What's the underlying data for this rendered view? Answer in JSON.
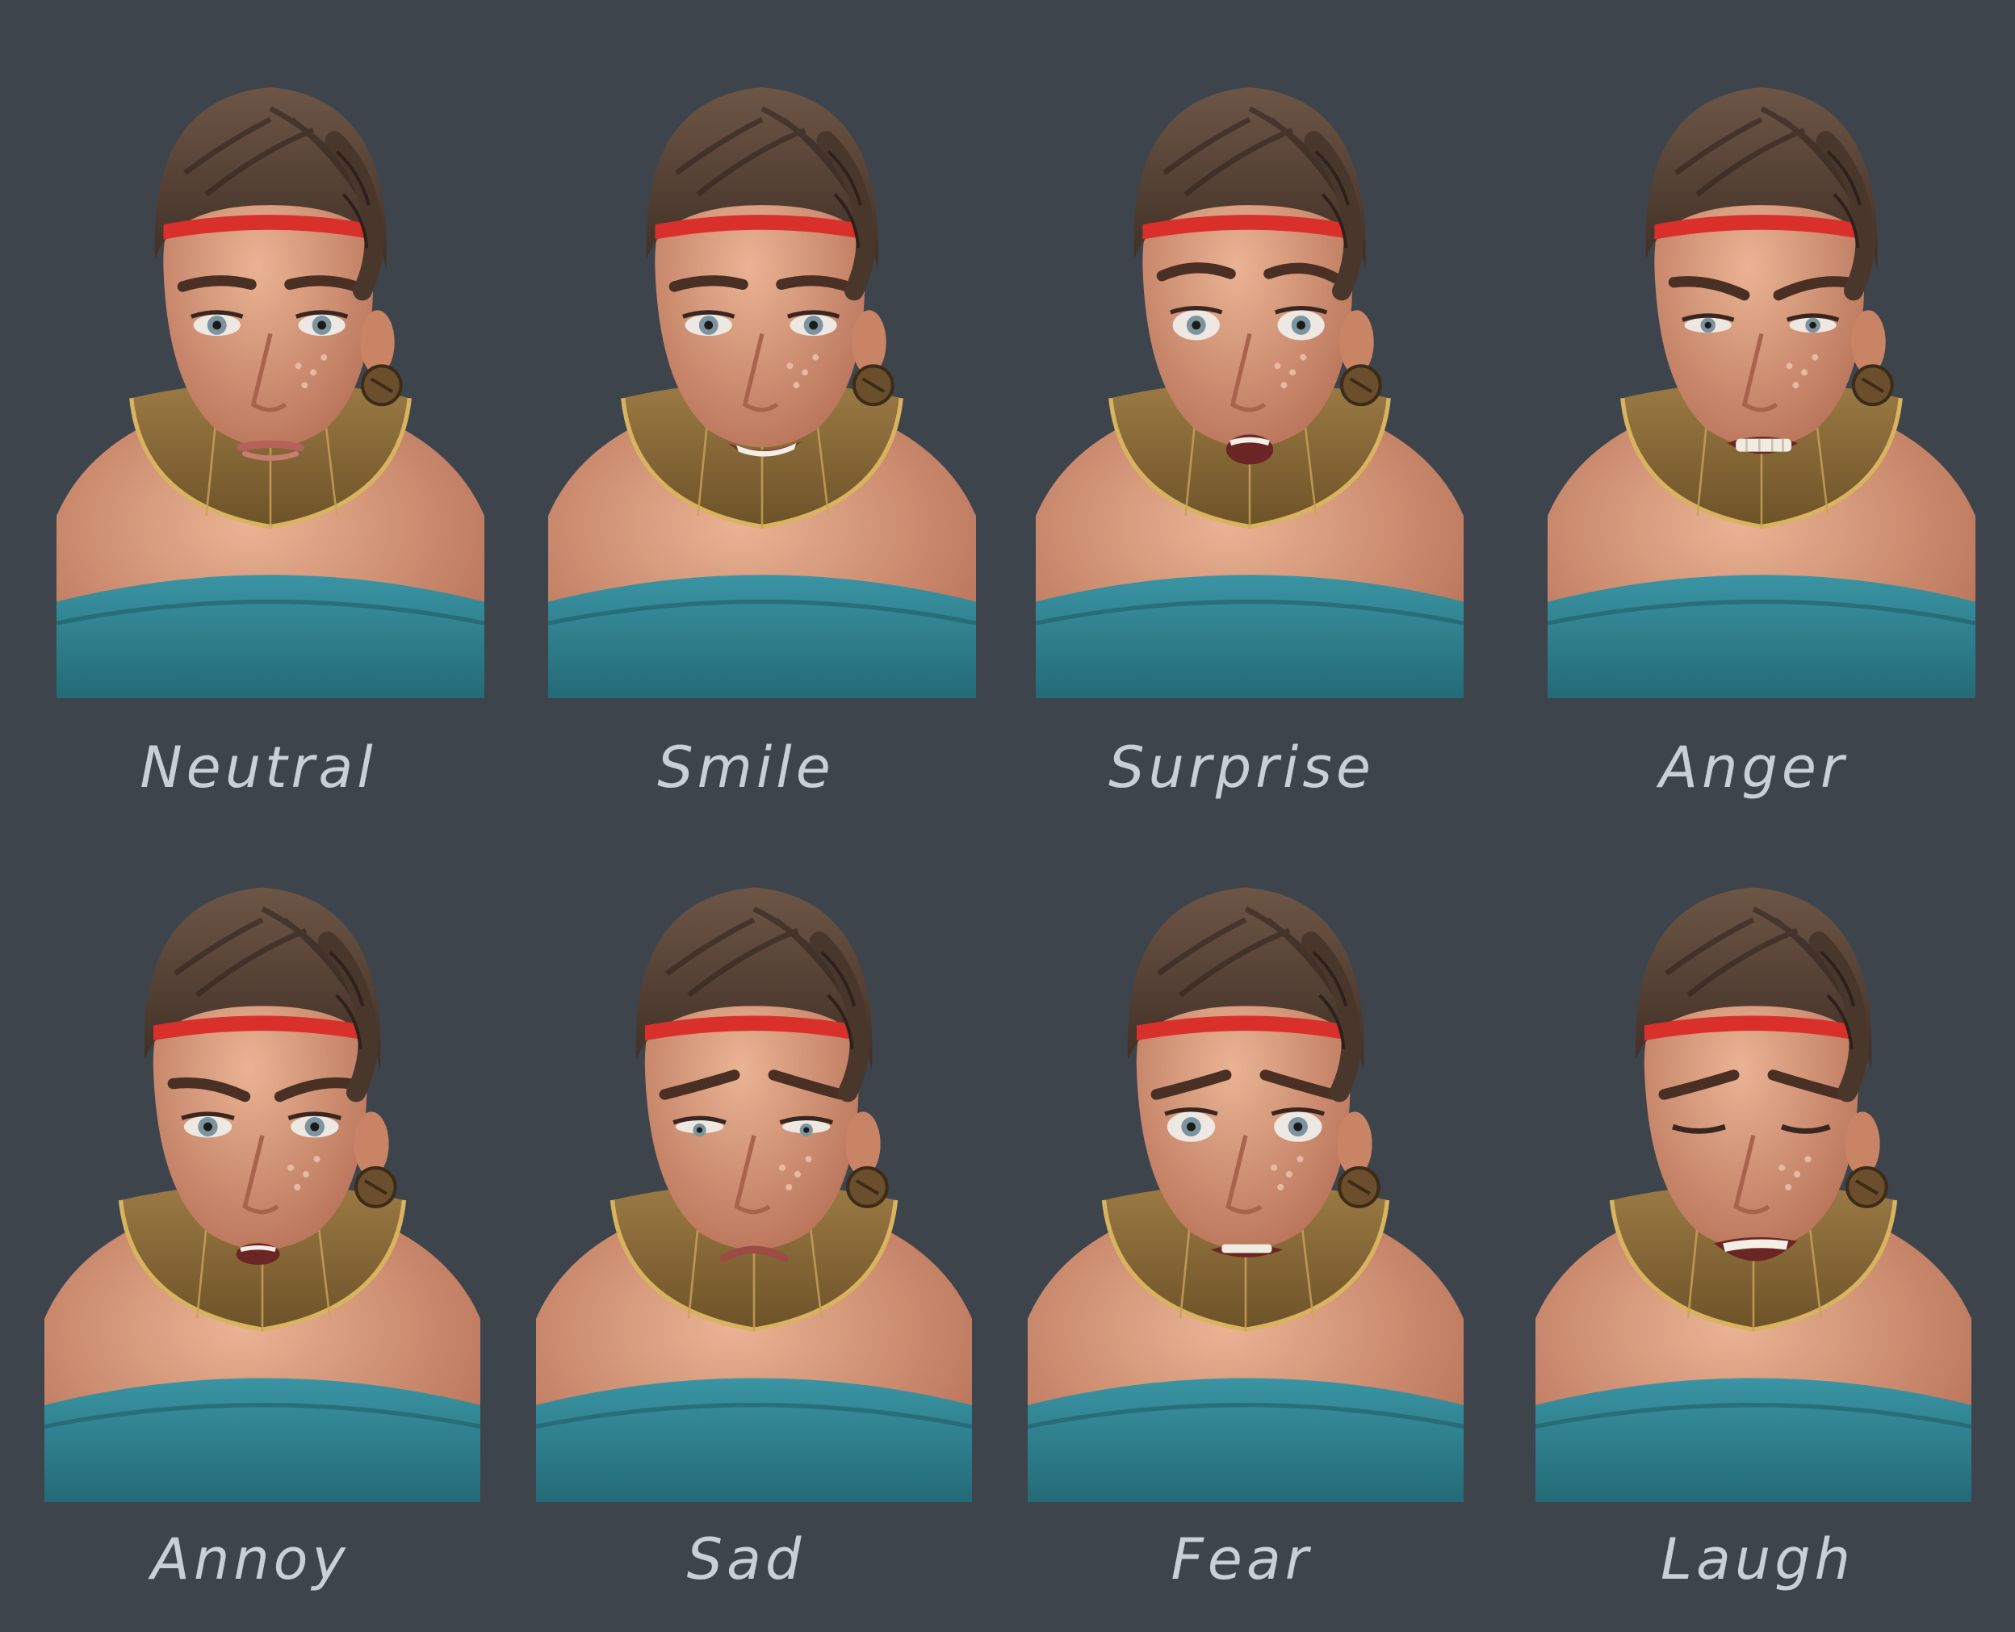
{
  "expressions": [
    {
      "label": "Neutral",
      "mouth": "neutral",
      "eyes": "open",
      "brows": "neutral"
    },
    {
      "label": "Smile",
      "mouth": "smile",
      "eyes": "open",
      "brows": "neutral"
    },
    {
      "label": "Surprise",
      "mouth": "open-o",
      "eyes": "wide",
      "brows": "raised"
    },
    {
      "label": "Anger",
      "mouth": "teeth-grit",
      "eyes": "narrow",
      "brows": "furrowed"
    },
    {
      "label": "Annoy",
      "mouth": "open-small",
      "eyes": "open",
      "brows": "furrowed"
    },
    {
      "label": "Sad",
      "mouth": "frown",
      "eyes": "lowered",
      "brows": "sad"
    },
    {
      "label": "Fear",
      "mouth": "teeth-tense",
      "eyes": "wide",
      "brows": "sad"
    },
    {
      "label": "Laugh",
      "mouth": "laugh",
      "eyes": "closed",
      "brows": "sad"
    }
  ],
  "colors": {
    "background": "#3e444b",
    "caption": "#c9cfd6",
    "skin": "#dc9a7e",
    "hair": "#5b463a",
    "headband": "#d9302c",
    "collar": "#8a6a3a",
    "cloth": "#2f8190"
  }
}
